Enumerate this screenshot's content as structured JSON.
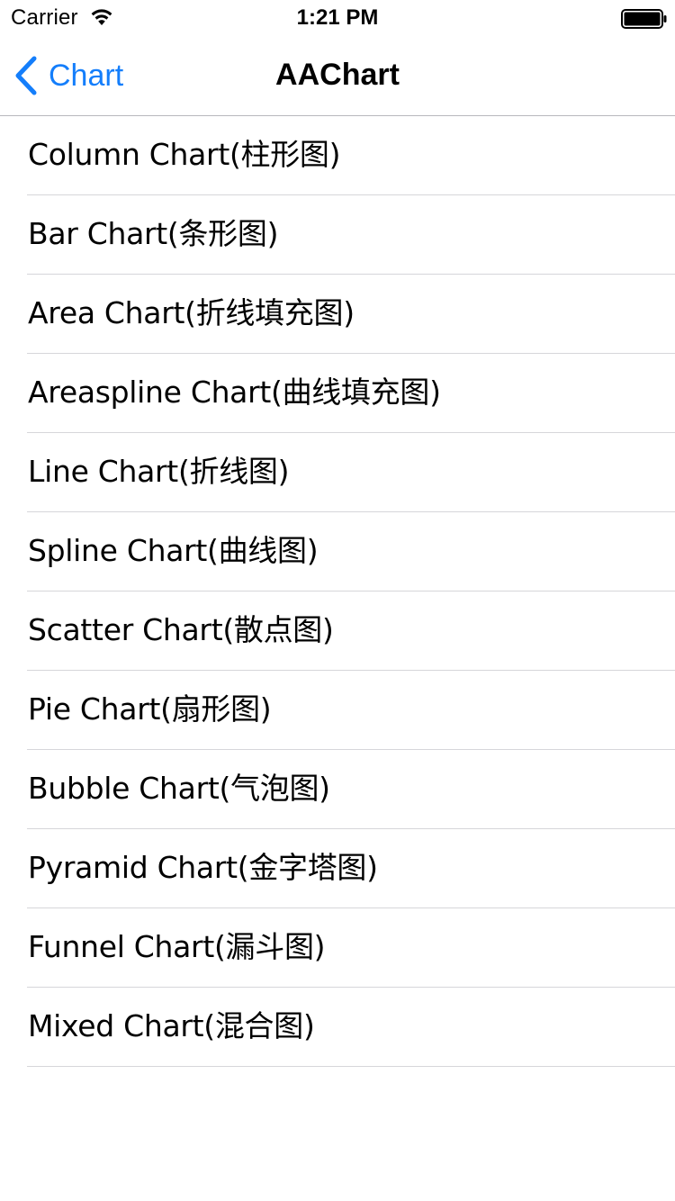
{
  "status_bar": {
    "carrier": "Carrier",
    "time": "1:21 PM",
    "wifi_icon": "wifi-icon",
    "battery_icon": "battery-icon"
  },
  "nav_bar": {
    "back_label": "Chart",
    "back_icon": "chevron-left-icon",
    "title": "AAChart",
    "accent_color": "#147efb"
  },
  "list": {
    "items": [
      {
        "label": "Column Chart(柱形图)"
      },
      {
        "label": "Bar Chart(条形图)"
      },
      {
        "label": "Area Chart(折线填充图)"
      },
      {
        "label": "Areaspline Chart(曲线填充图)"
      },
      {
        "label": "Line Chart(折线图)"
      },
      {
        "label": "Spline Chart(曲线图)"
      },
      {
        "label": "Scatter Chart(散点图)"
      },
      {
        "label": "Pie Chart(扇形图)"
      },
      {
        "label": "Bubble Chart(气泡图)"
      },
      {
        "label": "Pyramid Chart(金字塔图)"
      },
      {
        "label": "Funnel Chart(漏斗图)"
      },
      {
        "label": "Mixed Chart(混合图)"
      }
    ]
  }
}
